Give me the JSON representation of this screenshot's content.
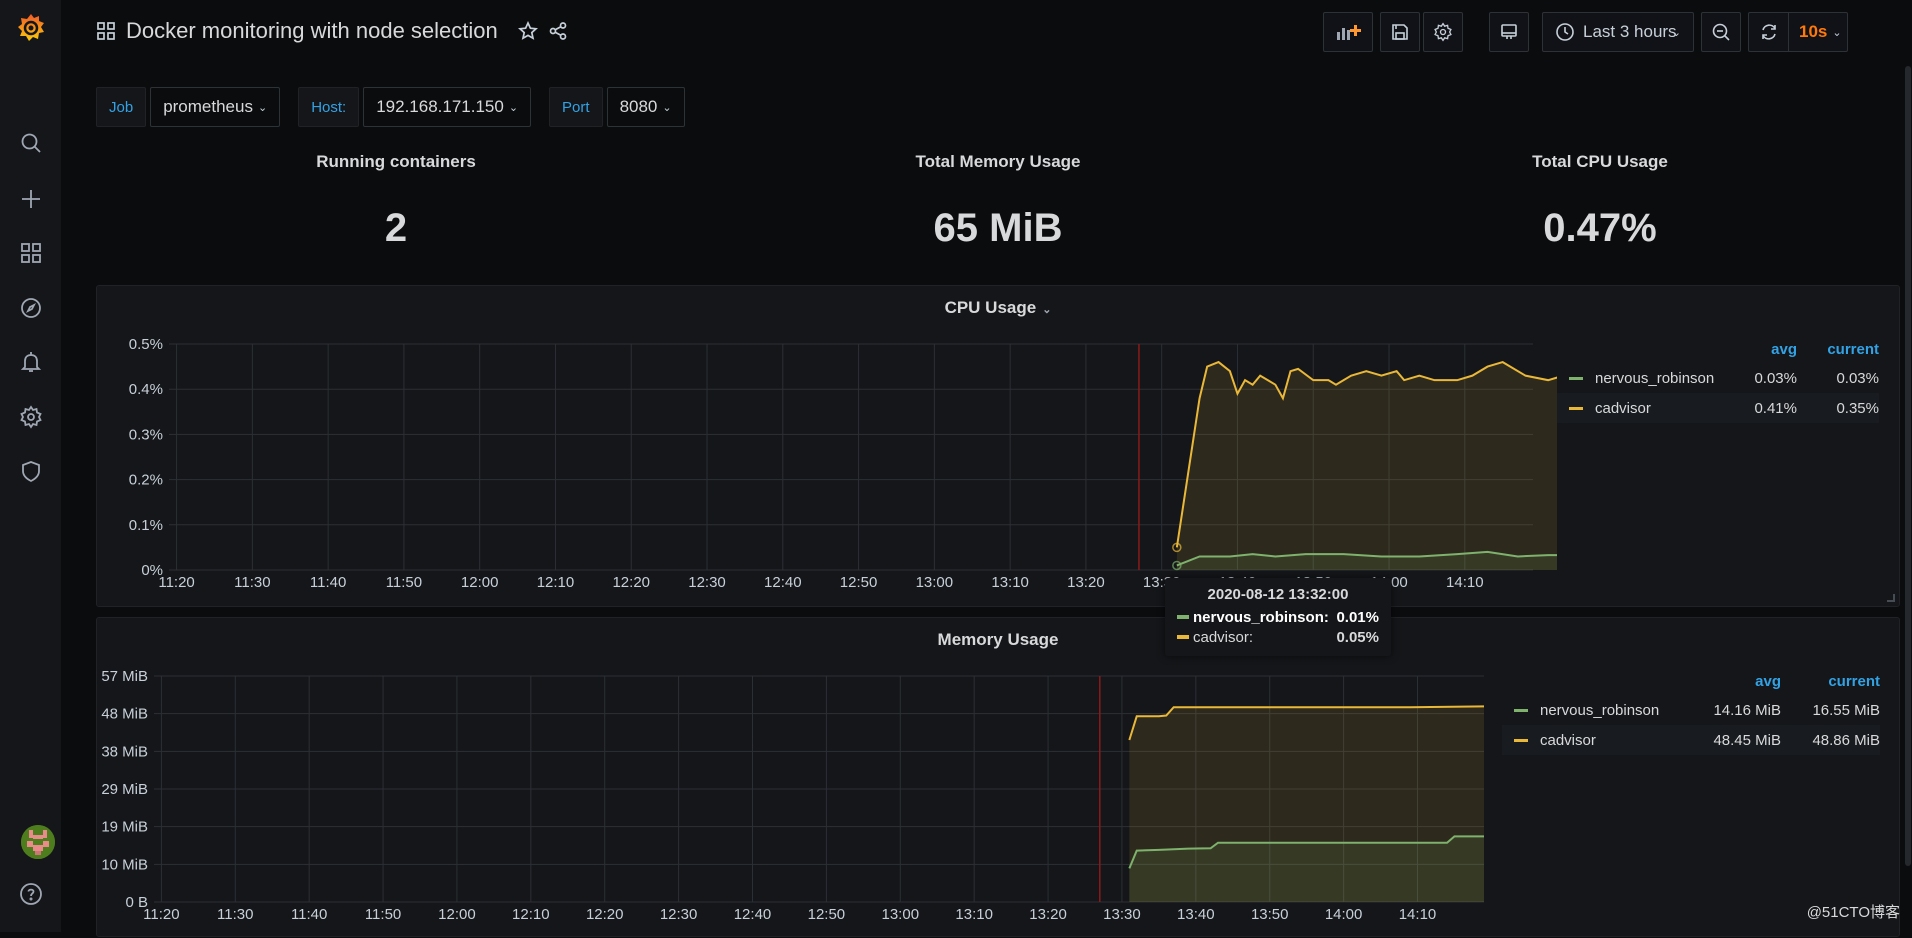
{
  "app": {
    "dashboard_title": "Docker monitoring with node selection",
    "brand_color": "#f47a20"
  },
  "sidebar": {
    "items": [
      {
        "name": "search",
        "icon": "search-icon"
      },
      {
        "name": "create",
        "icon": "plus-icon"
      },
      {
        "name": "dashboards",
        "icon": "apps-icon"
      },
      {
        "name": "explore",
        "icon": "compass-icon"
      },
      {
        "name": "alerting",
        "icon": "bell-icon"
      },
      {
        "name": "configuration",
        "icon": "gear-icon"
      },
      {
        "name": "server-admin",
        "icon": "shield-icon"
      }
    ],
    "bottom": [
      {
        "name": "profile",
        "icon": "avatar"
      },
      {
        "name": "help",
        "icon": "question-icon"
      }
    ]
  },
  "toolbar": {
    "time_range": "Last 3 hours",
    "refresh_interval": "10s",
    "refresh_color": "#ff780a",
    "buttons": [
      "add-panel",
      "save-dashboard",
      "dashboard-settings",
      "cycle-view-mode",
      "time-picker",
      "zoom-out",
      "refresh"
    ]
  },
  "variables": [
    {
      "label": "Job",
      "value": "prometheus"
    },
    {
      "label": "Host:",
      "value": "192.168.171.150"
    },
    {
      "label": "Port",
      "value": "8080"
    }
  ],
  "stats": [
    {
      "title": "Running containers",
      "value": "2"
    },
    {
      "title": "Total Memory Usage",
      "value": "65 MiB"
    },
    {
      "title": "Total CPU Usage",
      "value": "0.47%"
    }
  ],
  "legend_headers": {
    "avg": "avg",
    "current": "current"
  },
  "tooltip": {
    "time": "2020-08-12 13:32:00",
    "rows": [
      {
        "name": "nervous_robinson:",
        "value": "0.01%",
        "color": "#7eb26d"
      },
      {
        "name": "cadvisor:",
        "value": "0.05%",
        "color": "#eab839"
      }
    ]
  },
  "watermark": "@51CTO博客",
  "chart_data": [
    {
      "type": "area",
      "title": "CPU Usage",
      "xlabel": "",
      "ylabel": "",
      "x_ticks": [
        "11:20",
        "11:30",
        "11:40",
        "11:50",
        "12:00",
        "12:10",
        "12:20",
        "12:30",
        "12:40",
        "12:50",
        "13:00",
        "13:10",
        "13:20",
        "13:30",
        "13:40",
        "13:50",
        "14:00",
        "14:10"
      ],
      "x_range_minutes": [
        0,
        180
      ],
      "x_start": "11:19",
      "y_ticks": [
        "0%",
        "0.1%",
        "0.2%",
        "0.3%",
        "0.4%",
        "0.5%"
      ],
      "ylim": [
        0,
        0.5
      ],
      "unit": "%",
      "grid": true,
      "legend_position": "right",
      "annotation_time_min": 128,
      "series": [
        {
          "name": "nervous_robinson",
          "color": "#7eb26d",
          "avg": "0.03%",
          "current": "0.03%",
          "points": [
            [
              133,
              0.01
            ],
            [
              136,
              0.03
            ],
            [
              140,
              0.03
            ],
            [
              143,
              0.035
            ],
            [
              146,
              0.03
            ],
            [
              150,
              0.035
            ],
            [
              155,
              0.035
            ],
            [
              160,
              0.03
            ],
            [
              165,
              0.03
            ],
            [
              170,
              0.035
            ],
            [
              174,
              0.04
            ],
            [
              178,
              0.03
            ],
            [
              182,
              0.033
            ],
            [
              185,
              0.033
            ],
            [
              188,
              0.04
            ],
            [
              191,
              0.03
            ],
            [
              193,
              0.025
            ]
          ]
        },
        {
          "name": "cadvisor",
          "color": "#eab839",
          "avg": "0.41%",
          "current": "0.35%",
          "points": [
            [
              133,
              0.05
            ],
            [
              136,
              0.38
            ],
            [
              137,
              0.45
            ],
            [
              138.5,
              0.46
            ],
            [
              140,
              0.44
            ],
            [
              141,
              0.39
            ],
            [
              142,
              0.42
            ],
            [
              143,
              0.41
            ],
            [
              144,
              0.43
            ],
            [
              146,
              0.41
            ],
            [
              147,
              0.38
            ],
            [
              148,
              0.44
            ],
            [
              149,
              0.445
            ],
            [
              151,
              0.42
            ],
            [
              153,
              0.42
            ],
            [
              154,
              0.41
            ],
            [
              156,
              0.43
            ],
            [
              158,
              0.44
            ],
            [
              160,
              0.43
            ],
            [
              162,
              0.44
            ],
            [
              163,
              0.42
            ],
            [
              165,
              0.43
            ],
            [
              167,
              0.42
            ],
            [
              170,
              0.42
            ],
            [
              172,
              0.43
            ],
            [
              174,
              0.45
            ],
            [
              176,
              0.46
            ],
            [
              177,
              0.45
            ],
            [
              179,
              0.43
            ],
            [
              182,
              0.42
            ],
            [
              184,
              0.43
            ],
            [
              187,
              0.42
            ],
            [
              189,
              0.43
            ],
            [
              192,
              0.43
            ],
            [
              193,
              0.4
            ],
            [
              194,
              0.35
            ]
          ]
        }
      ]
    },
    {
      "type": "area",
      "title": "Memory Usage",
      "xlabel": "",
      "ylabel": "",
      "x_ticks": [
        "11:20",
        "11:30",
        "11:40",
        "11:50",
        "12:00",
        "12:10",
        "12:20",
        "12:30",
        "12:40",
        "12:50",
        "13:00",
        "13:10",
        "13:20",
        "13:30",
        "13:40",
        "13:50",
        "14:00",
        "14:10"
      ],
      "x_range_minutes": [
        0,
        180
      ],
      "x_start": "11:19",
      "y_ticks": [
        "0 B",
        "10 MiB",
        "19 MiB",
        "29 MiB",
        "38 MiB",
        "48 MiB",
        "57 MiB"
      ],
      "ylim": [
        0,
        57.2
      ],
      "unit": "MiB",
      "grid": true,
      "legend_position": "right",
      "annotation_time_min": 128,
      "series": [
        {
          "name": "nervous_robinson",
          "color": "#7eb26d",
          "avg": "14.16 MiB",
          "current": "16.55 MiB",
          "points": [
            [
              132,
              8.5
            ],
            [
              133,
              13
            ],
            [
              136,
              13.2
            ],
            [
              140,
              13.5
            ],
            [
              143,
              13.6
            ],
            [
              144,
              15
            ],
            [
              150,
              15
            ],
            [
              160,
              15
            ],
            [
              170,
              15
            ],
            [
              175,
              15
            ],
            [
              176,
              16.6
            ],
            [
              180,
              16.6
            ]
          ]
        },
        {
          "name": "cadvisor",
          "color": "#eab839",
          "avg": "48.45 MiB",
          "current": "48.86 MiB",
          "points": [
            [
              132,
              41
            ],
            [
              133,
              47
            ],
            [
              136,
              47
            ],
            [
              137,
              47.2
            ],
            [
              138,
              49.3
            ],
            [
              150,
              49.3
            ],
            [
              160,
              49.3
            ],
            [
              170,
              49.3
            ],
            [
              180,
              49.5
            ]
          ]
        }
      ]
    }
  ]
}
